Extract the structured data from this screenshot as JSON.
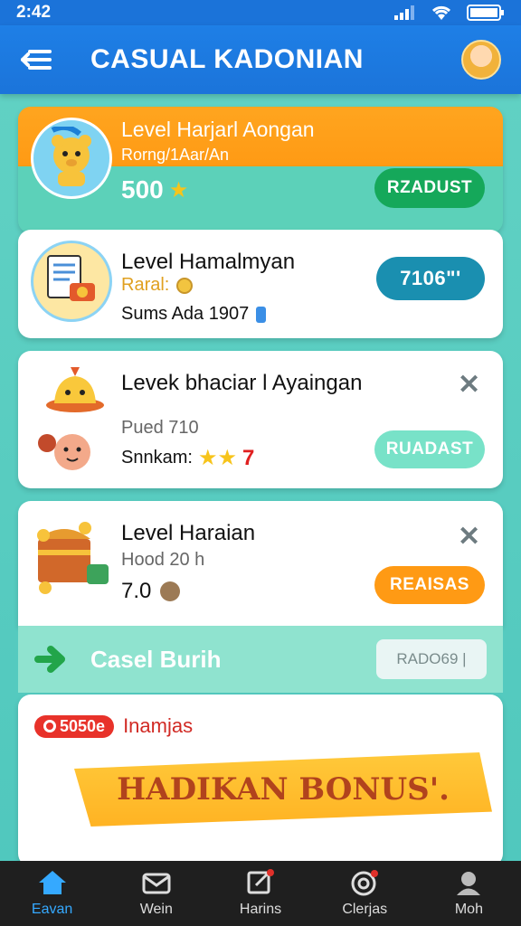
{
  "status_bar": {
    "time": "2:42"
  },
  "header": {
    "title": "CASUAL KADONIAN"
  },
  "cards": [
    {
      "title": "Level Harjarl Aongan",
      "subtitle": "Rorng/1Aar/An",
      "reward": "500",
      "button": "RZADUST",
      "button_color": "#15a85a"
    },
    {
      "title": "Level Hamalmyan",
      "line2": "Raral:",
      "line3": "Sums  Ada 1907",
      "button": "7106\"'",
      "button_color": "#1a8fb0"
    },
    {
      "title": "Levek bhaciar l Ayaingan",
      "line2": "Pued 710",
      "line3": "Snnkam:",
      "rating": "7",
      "button": "RUADAST",
      "button_color": "#78e2c8"
    },
    {
      "title": "Level Haraian",
      "line2": "Hood 20 h",
      "line3": "7.0",
      "button": "REAISAS",
      "button_color": "#ff9a14"
    }
  ],
  "burst": {
    "title": "Casel Burih",
    "button": "RADO69 |"
  },
  "bonus": {
    "tag": "5050e",
    "label": "Inamjas",
    "banner": "HADIKAN BONUS'."
  },
  "nav": [
    {
      "label": "Eavan",
      "icon": "home-icon",
      "active": true
    },
    {
      "label": "Wein",
      "icon": "envelope-icon",
      "active": false
    },
    {
      "label": "Harins",
      "icon": "edit-icon",
      "active": false
    },
    {
      "label": "Clerjas",
      "icon": "target-icon",
      "active": false
    },
    {
      "label": "Moh",
      "icon": "profile-icon",
      "active": false
    }
  ],
  "colors": {
    "header": "#1b74da",
    "background": "#5cd1b9",
    "accent_orange": "#ff9a14"
  }
}
